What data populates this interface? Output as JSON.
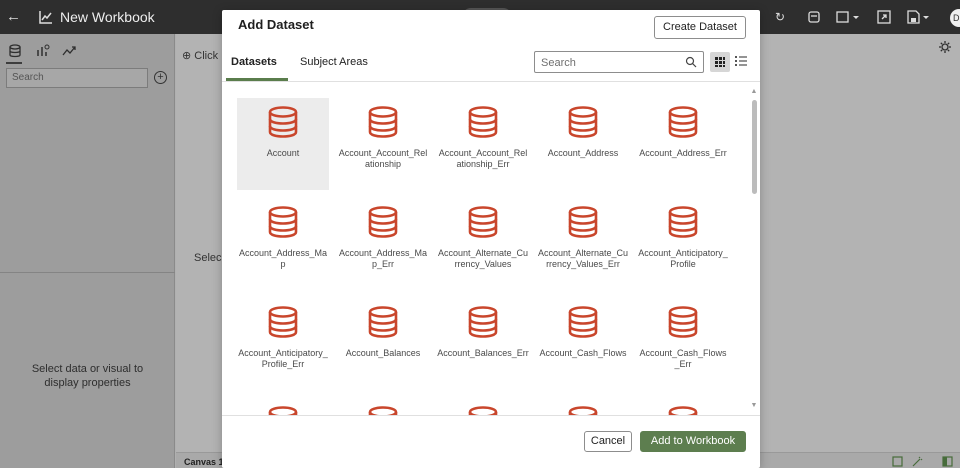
{
  "app": {
    "title": "New Workbook",
    "avatar_text": "D"
  },
  "left_panel": {
    "search_placeholder": "Search",
    "properties_text": "Select data or visual to display properties"
  },
  "canvas": {
    "click_text": "Click",
    "select_text": "Selec",
    "tab_name": "Canvas 1"
  },
  "modal": {
    "title": "Add Dataset",
    "create_label": "Create Dataset",
    "tabs": [
      {
        "label": "Datasets",
        "active": true
      },
      {
        "label": "Subject Areas",
        "active": false
      }
    ],
    "search_placeholder": "Search",
    "cancel_label": "Cancel",
    "add_label": "Add to Workbook",
    "accent_color": "#5d7e4f",
    "icon_color": "#c9462c",
    "items": [
      {
        "label": "Account",
        "selected": true
      },
      {
        "label": "Account_Account_Relationship"
      },
      {
        "label": "Account_Account_Relationship_Err"
      },
      {
        "label": "Account_Address"
      },
      {
        "label": "Account_Address_Err"
      },
      {
        "label": "Account_Address_Map"
      },
      {
        "label": "Account_Address_Map_Err"
      },
      {
        "label": "Account_Alternate_Currency_Values"
      },
      {
        "label": "Account_Alternate_Currency_Values_Err"
      },
      {
        "label": "Account_Anticipatory_Profile"
      },
      {
        "label": "Account_Anticipatory_Profile_Err"
      },
      {
        "label": "Account_Balances"
      },
      {
        "label": "Account_Balances_Err"
      },
      {
        "label": "Account_Cash_Flows"
      },
      {
        "label": "Account_Cash_Flows_Err"
      },
      {
        "label": ""
      },
      {
        "label": ""
      },
      {
        "label": ""
      },
      {
        "label": ""
      },
      {
        "label": ""
      }
    ]
  }
}
